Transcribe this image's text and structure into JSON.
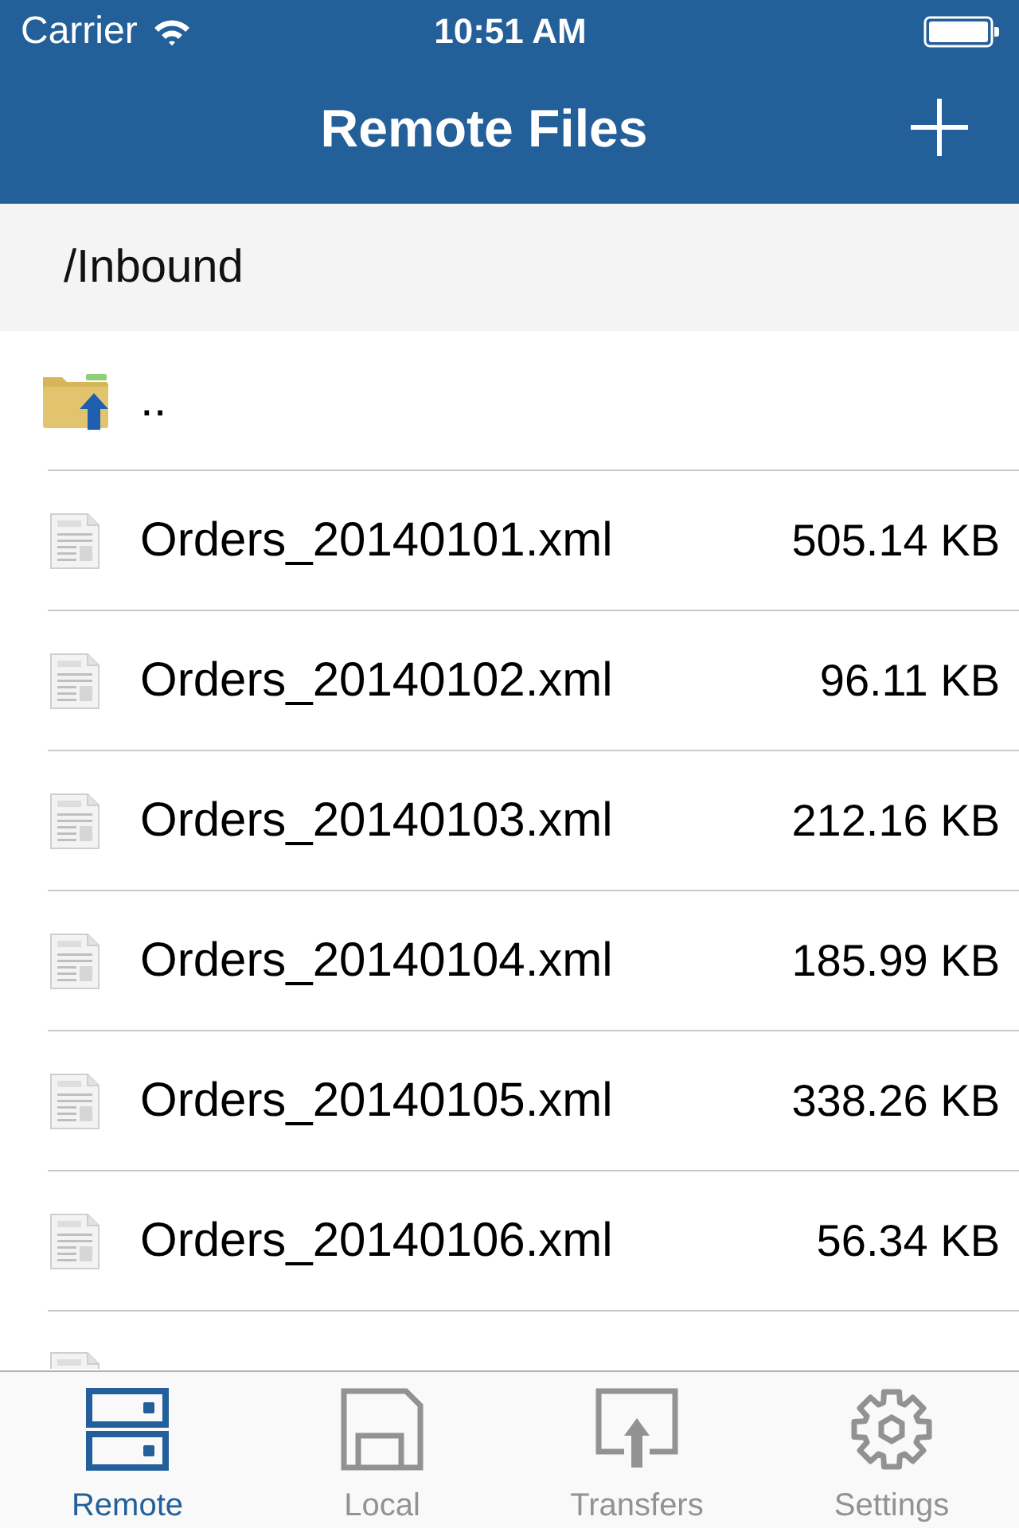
{
  "status_bar": {
    "carrier": "Carrier",
    "time": "10:51 AM"
  },
  "nav_bar": {
    "title": "Remote Files"
  },
  "path": "/Inbound",
  "files": [
    {
      "kind": "parent",
      "name": ".."
    },
    {
      "kind": "file",
      "name": "Orders_20140101.xml",
      "size": "505.14 KB"
    },
    {
      "kind": "file",
      "name": "Orders_20140102.xml",
      "size": "96.11 KB"
    },
    {
      "kind": "file",
      "name": "Orders_20140103.xml",
      "size": "212.16 KB"
    },
    {
      "kind": "file",
      "name": "Orders_20140104.xml",
      "size": "185.99 KB"
    },
    {
      "kind": "file",
      "name": "Orders_20140105.xml",
      "size": "338.26 KB"
    },
    {
      "kind": "file",
      "name": "Orders_20140106.xml",
      "size": "56.34 KB"
    },
    {
      "kind": "file"
    }
  ],
  "tab_bar": [
    {
      "kind": "remote",
      "label": "Remote",
      "selected": true
    },
    {
      "kind": "local",
      "label": "Local",
      "selected": false
    },
    {
      "kind": "transfers",
      "label": "Transfers",
      "selected": false
    },
    {
      "kind": "settings",
      "label": "Settings",
      "selected": false
    }
  ]
}
